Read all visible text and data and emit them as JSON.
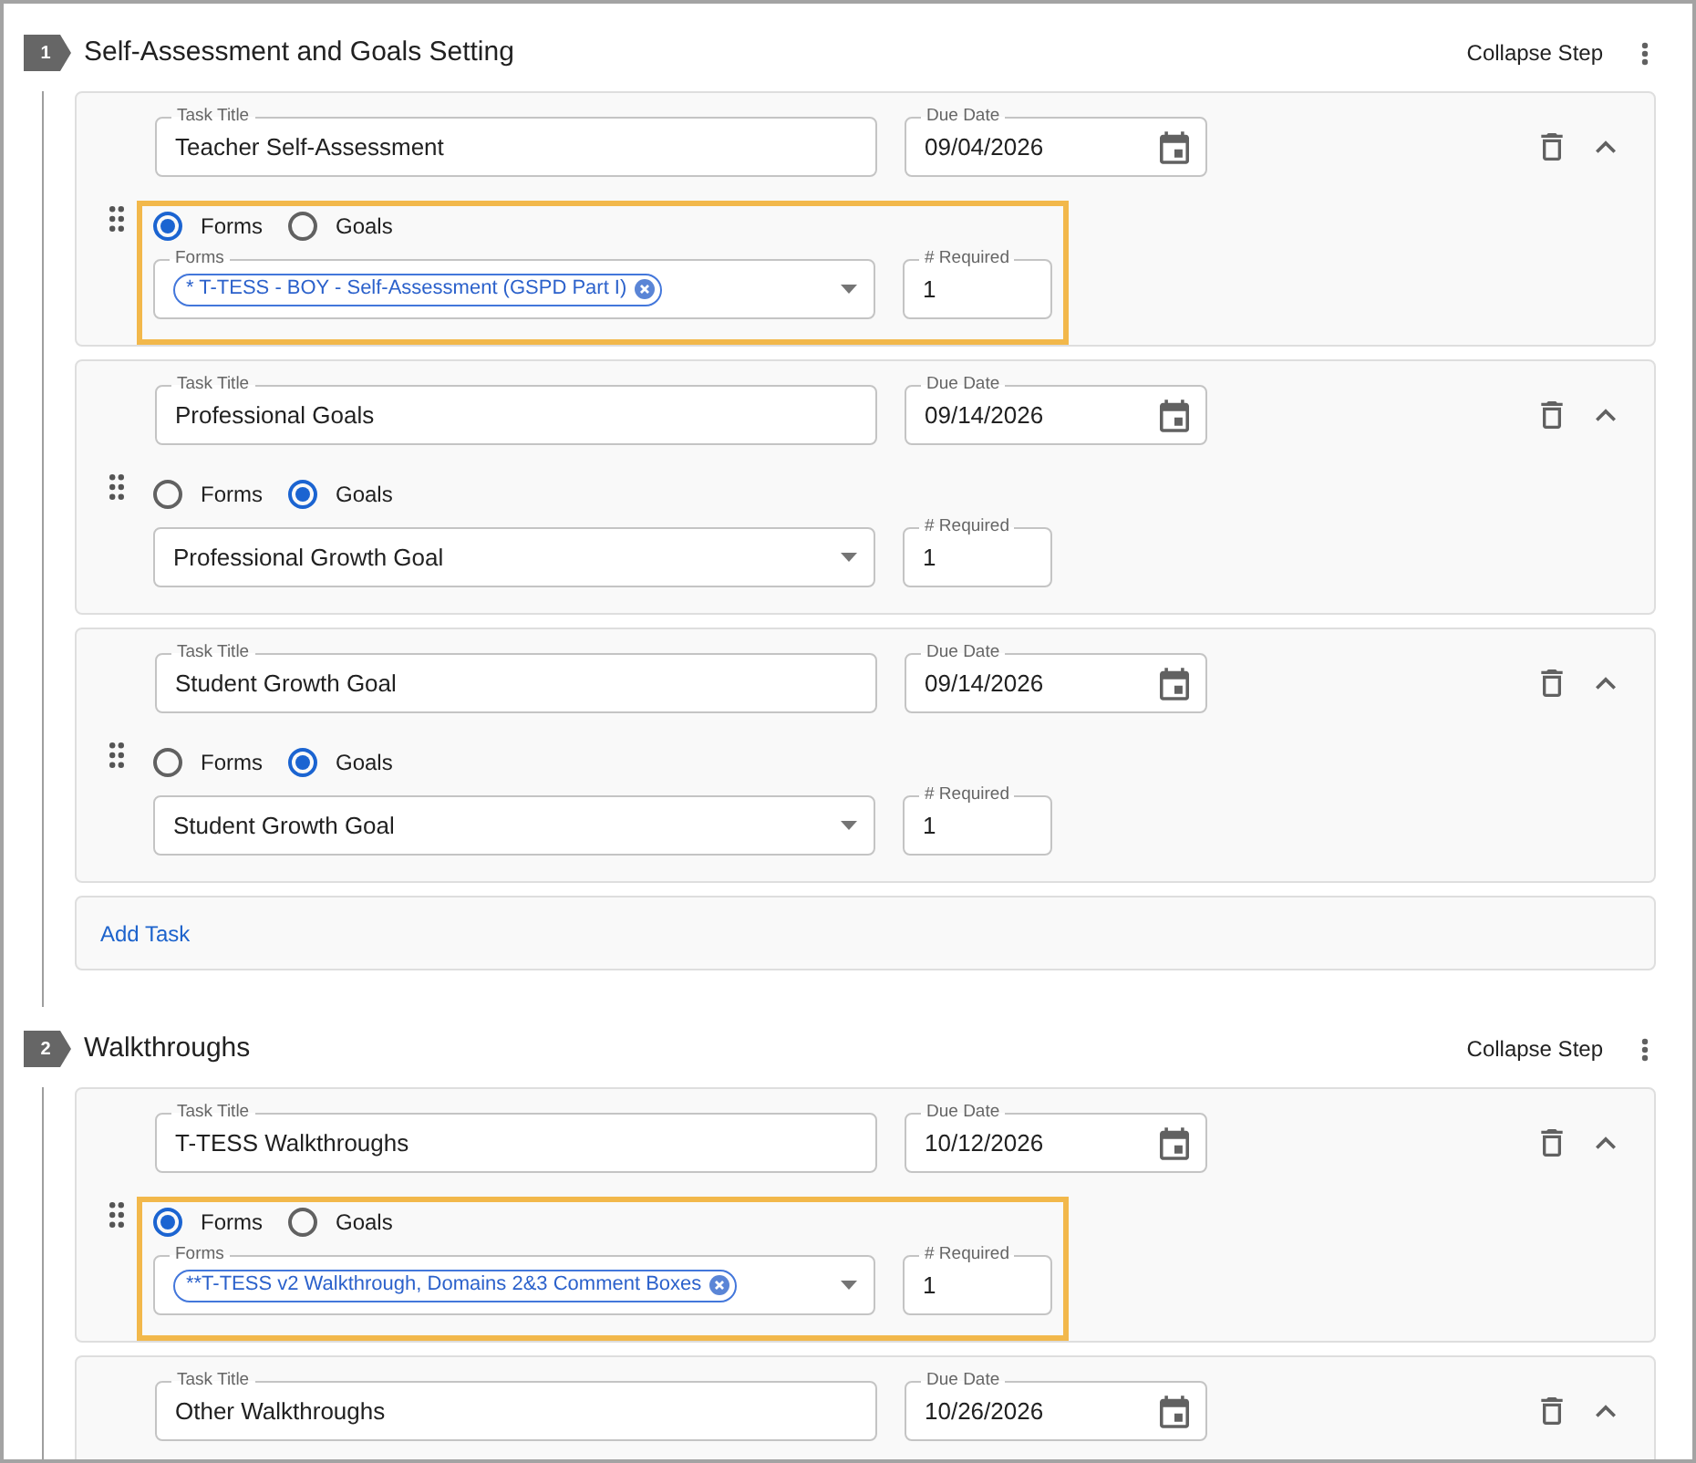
{
  "steps": [
    {
      "number": "1",
      "title": "Self-Assessment and Goals Setting",
      "collapse_label": "Collapse Step",
      "tasks": [
        {
          "title_label": "Task Title",
          "title": "Teacher Self-Assessment",
          "due_label": "Due Date",
          "due_date": "09/04/2026",
          "highlighted": true,
          "options": [
            {
              "label": "Forms",
              "selected": true
            },
            {
              "label": "Goals",
              "selected": false
            }
          ],
          "select": {
            "label": "Forms",
            "chips": [
              "* T-TESS - BOY - Self-Assessment (GSPD Part I)"
            ]
          },
          "required_label": "# Required",
          "required": "1"
        },
        {
          "title_label": "Task Title",
          "title": "Professional Goals",
          "due_label": "Due Date",
          "due_date": "09/14/2026",
          "highlighted": false,
          "options": [
            {
              "label": "Forms",
              "selected": false
            },
            {
              "label": "Goals",
              "selected": true
            }
          ],
          "select": {
            "value": "Professional Growth Goal"
          },
          "required_label": "# Required",
          "required": "1"
        },
        {
          "title_label": "Task Title",
          "title": "Student Growth Goal",
          "due_label": "Due Date",
          "due_date": "09/14/2026",
          "highlighted": false,
          "options": [
            {
              "label": "Forms",
              "selected": false
            },
            {
              "label": "Goals",
              "selected": true
            }
          ],
          "select": {
            "value": "Student Growth Goal"
          },
          "required_label": "# Required",
          "required": "1"
        }
      ],
      "add_task": "Add Task"
    },
    {
      "number": "2",
      "title": "Walkthroughs",
      "collapse_label": "Collapse Step",
      "tasks": [
        {
          "title_label": "Task Title",
          "title": "T-TESS Walkthroughs",
          "due_label": "Due Date",
          "due_date": "10/12/2026",
          "highlighted": true,
          "options": [
            {
              "label": "Forms",
              "selected": true
            },
            {
              "label": "Goals",
              "selected": false
            }
          ],
          "select": {
            "label": "Forms",
            "chips": [
              "**T-TESS v2 Walkthrough, Domains 2&3 Comment Boxes"
            ]
          },
          "required_label": "# Required",
          "required": "1"
        },
        {
          "title_label": "Task Title",
          "title": "Other Walkthroughs",
          "due_label": "Due Date",
          "due_date": "10/26/2026"
        }
      ]
    }
  ]
}
